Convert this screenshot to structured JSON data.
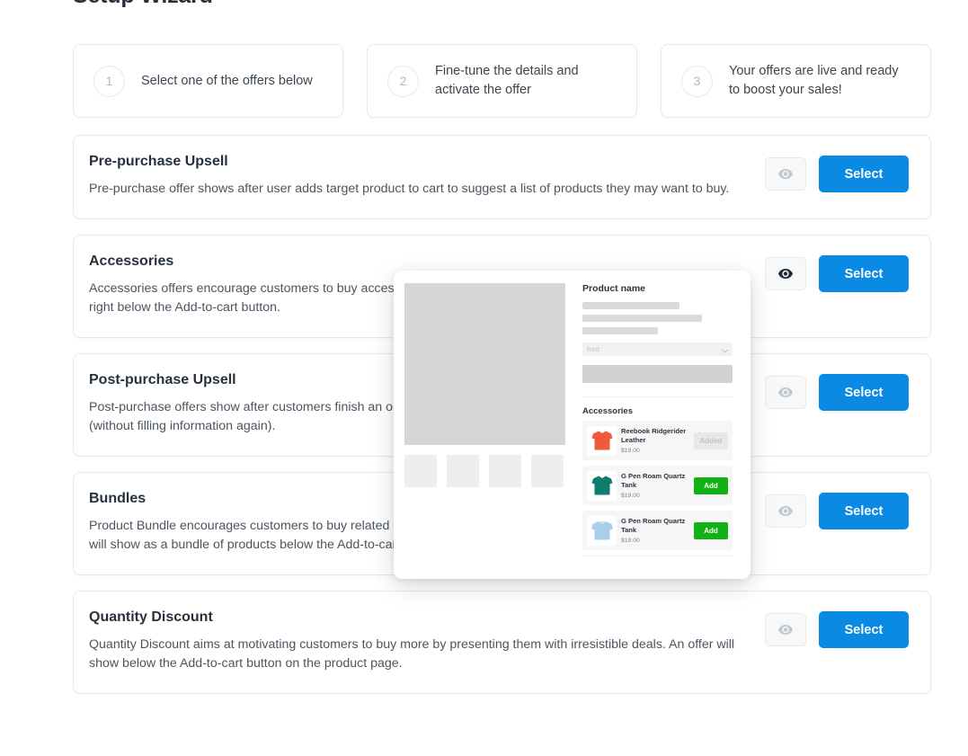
{
  "page_title": "Setup Wizard",
  "colors": {
    "primary_button": "#0b8ae4",
    "add_button_green": "#12b115",
    "card_border": "#e7e9eb",
    "heading_text": "#27313d",
    "body_text": "#4b5560"
  },
  "steps": [
    {
      "number": "1",
      "text": "Select one of the offers below"
    },
    {
      "number": "2",
      "text": "Fine-tune the details and activate the offer"
    },
    {
      "number": "3",
      "text": "Your offers are live and ready to boost your sales!"
    }
  ],
  "offers": [
    {
      "title": "Pre-purchase Upsell",
      "description": "Pre-purchase offer shows after user adds target product to cart to suggest a list of products they may want to buy.",
      "preview_label": "preview-eye-icon",
      "preview_active": false,
      "select_label": "Select"
    },
    {
      "title": "Accessories",
      "description": "Accessories offers encourage customers to buy accessories along with the main products. Accessories will be listed right below the Add-to-cart button.",
      "preview_label": "preview-eye-icon",
      "preview_active": true,
      "select_label": "Select"
    },
    {
      "title": "Post-purchase Upsell",
      "description": "Post-purchase offers show after customers finish an order to suggest products they may want to purchase as well (without filling information again).",
      "preview_label": "preview-eye-icon",
      "preview_active": false,
      "select_label": "Select"
    },
    {
      "title": "Bundles",
      "description": "Product Bundle encourages customers to buy related or matching products by view pre-selected products. An offer will show as a bundle of products below the Add-to-cart button on the product page.",
      "preview_label": "preview-eye-icon",
      "preview_active": false,
      "select_label": "Select"
    },
    {
      "title": "Quantity Discount",
      "description": "Quantity Discount aims at motivating customers to buy more by presenting them with irresistible deals. An offer will show below the Add-to-cart button on the product page.",
      "preview_label": "preview-eye-icon",
      "preview_active": false,
      "select_label": "Select"
    }
  ],
  "preview_popup": {
    "product_name_heading": "Product name",
    "variant_select_value": "Red",
    "accessories_heading": "Accessories",
    "items": [
      {
        "name": "Reebook Ridgerider Leather",
        "price": "$19.00",
        "button_label": "Added",
        "added": true,
        "swatch": "#f05a3c"
      },
      {
        "name": "G Pen Roam Quartz Tank",
        "price": "$19.00",
        "button_label": "Add",
        "added": false,
        "swatch": "#0d7d6e"
      },
      {
        "name": "G Pen Roam Quartz Tank",
        "price": "$19.00",
        "button_label": "Add",
        "added": false,
        "swatch": "#a7cfe8"
      }
    ]
  }
}
